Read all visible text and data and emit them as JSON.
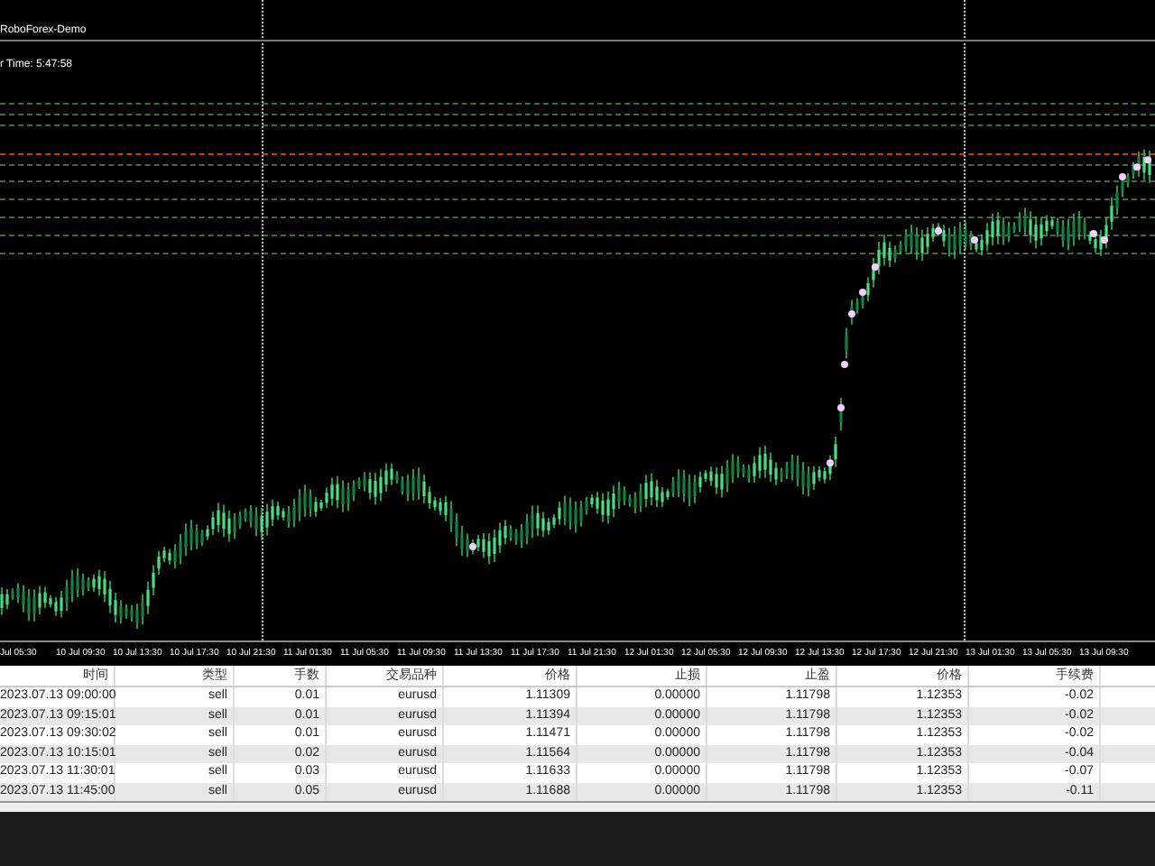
{
  "chart": {
    "account": "RoboForex-Demo",
    "timer": "r Time: 5:47:58",
    "time_axis": [
      "Jul 05:30",
      "10 Jul 09:30",
      "10 Jul 13:30",
      "10 Jul 17:30",
      "10 Jul 21:30",
      "11 Jul 01:30",
      "11 Jul 05:30",
      "11 Jul 09:30",
      "11 Jul 13:30",
      "11 Jul 17:30",
      "11 Jul 21:30",
      "12 Jul 01:30",
      "12 Jul 05:30",
      "12 Jul 09:30",
      "12 Jul 13:30",
      "12 Jul 17:30",
      "12 Jul 21:30",
      "13 Jul 01:30",
      "13 Jul 05:30",
      "13 Jul 09:30"
    ]
  },
  "table": {
    "columns": [
      "时间",
      "类型",
      "手数",
      "交易品种",
      "价格",
      "止损",
      "止盈",
      "价格",
      "手续费"
    ],
    "rows": [
      [
        "2023.07.13 09:00:00",
        "sell",
        "0.01",
        "eurusd",
        "1.11309",
        "0.00000",
        "1.11798",
        "1.12353",
        "-0.02"
      ],
      [
        "2023.07.13 09:15:01",
        "sell",
        "0.01",
        "eurusd",
        "1.11394",
        "0.00000",
        "1.11798",
        "1.12353",
        "-0.02"
      ],
      [
        "2023.07.13 09:30:02",
        "sell",
        "0.01",
        "eurusd",
        "1.11471",
        "0.00000",
        "1.11798",
        "1.12353",
        "-0.02"
      ],
      [
        "2023.07.13 10:15:01",
        "sell",
        "0.02",
        "eurusd",
        "1.11564",
        "0.00000",
        "1.11798",
        "1.12353",
        "-0.04"
      ],
      [
        "2023.07.13 11:30:01",
        "sell",
        "0.03",
        "eurusd",
        "1.11633",
        "0.00000",
        "1.11798",
        "1.12353",
        "-0.07"
      ],
      [
        "2023.07.13 11:45:00",
        "sell",
        "0.05",
        "eurusd",
        "1.11688",
        "0.00000",
        "1.11798",
        "1.12353",
        "-0.11"
      ]
    ]
  }
}
